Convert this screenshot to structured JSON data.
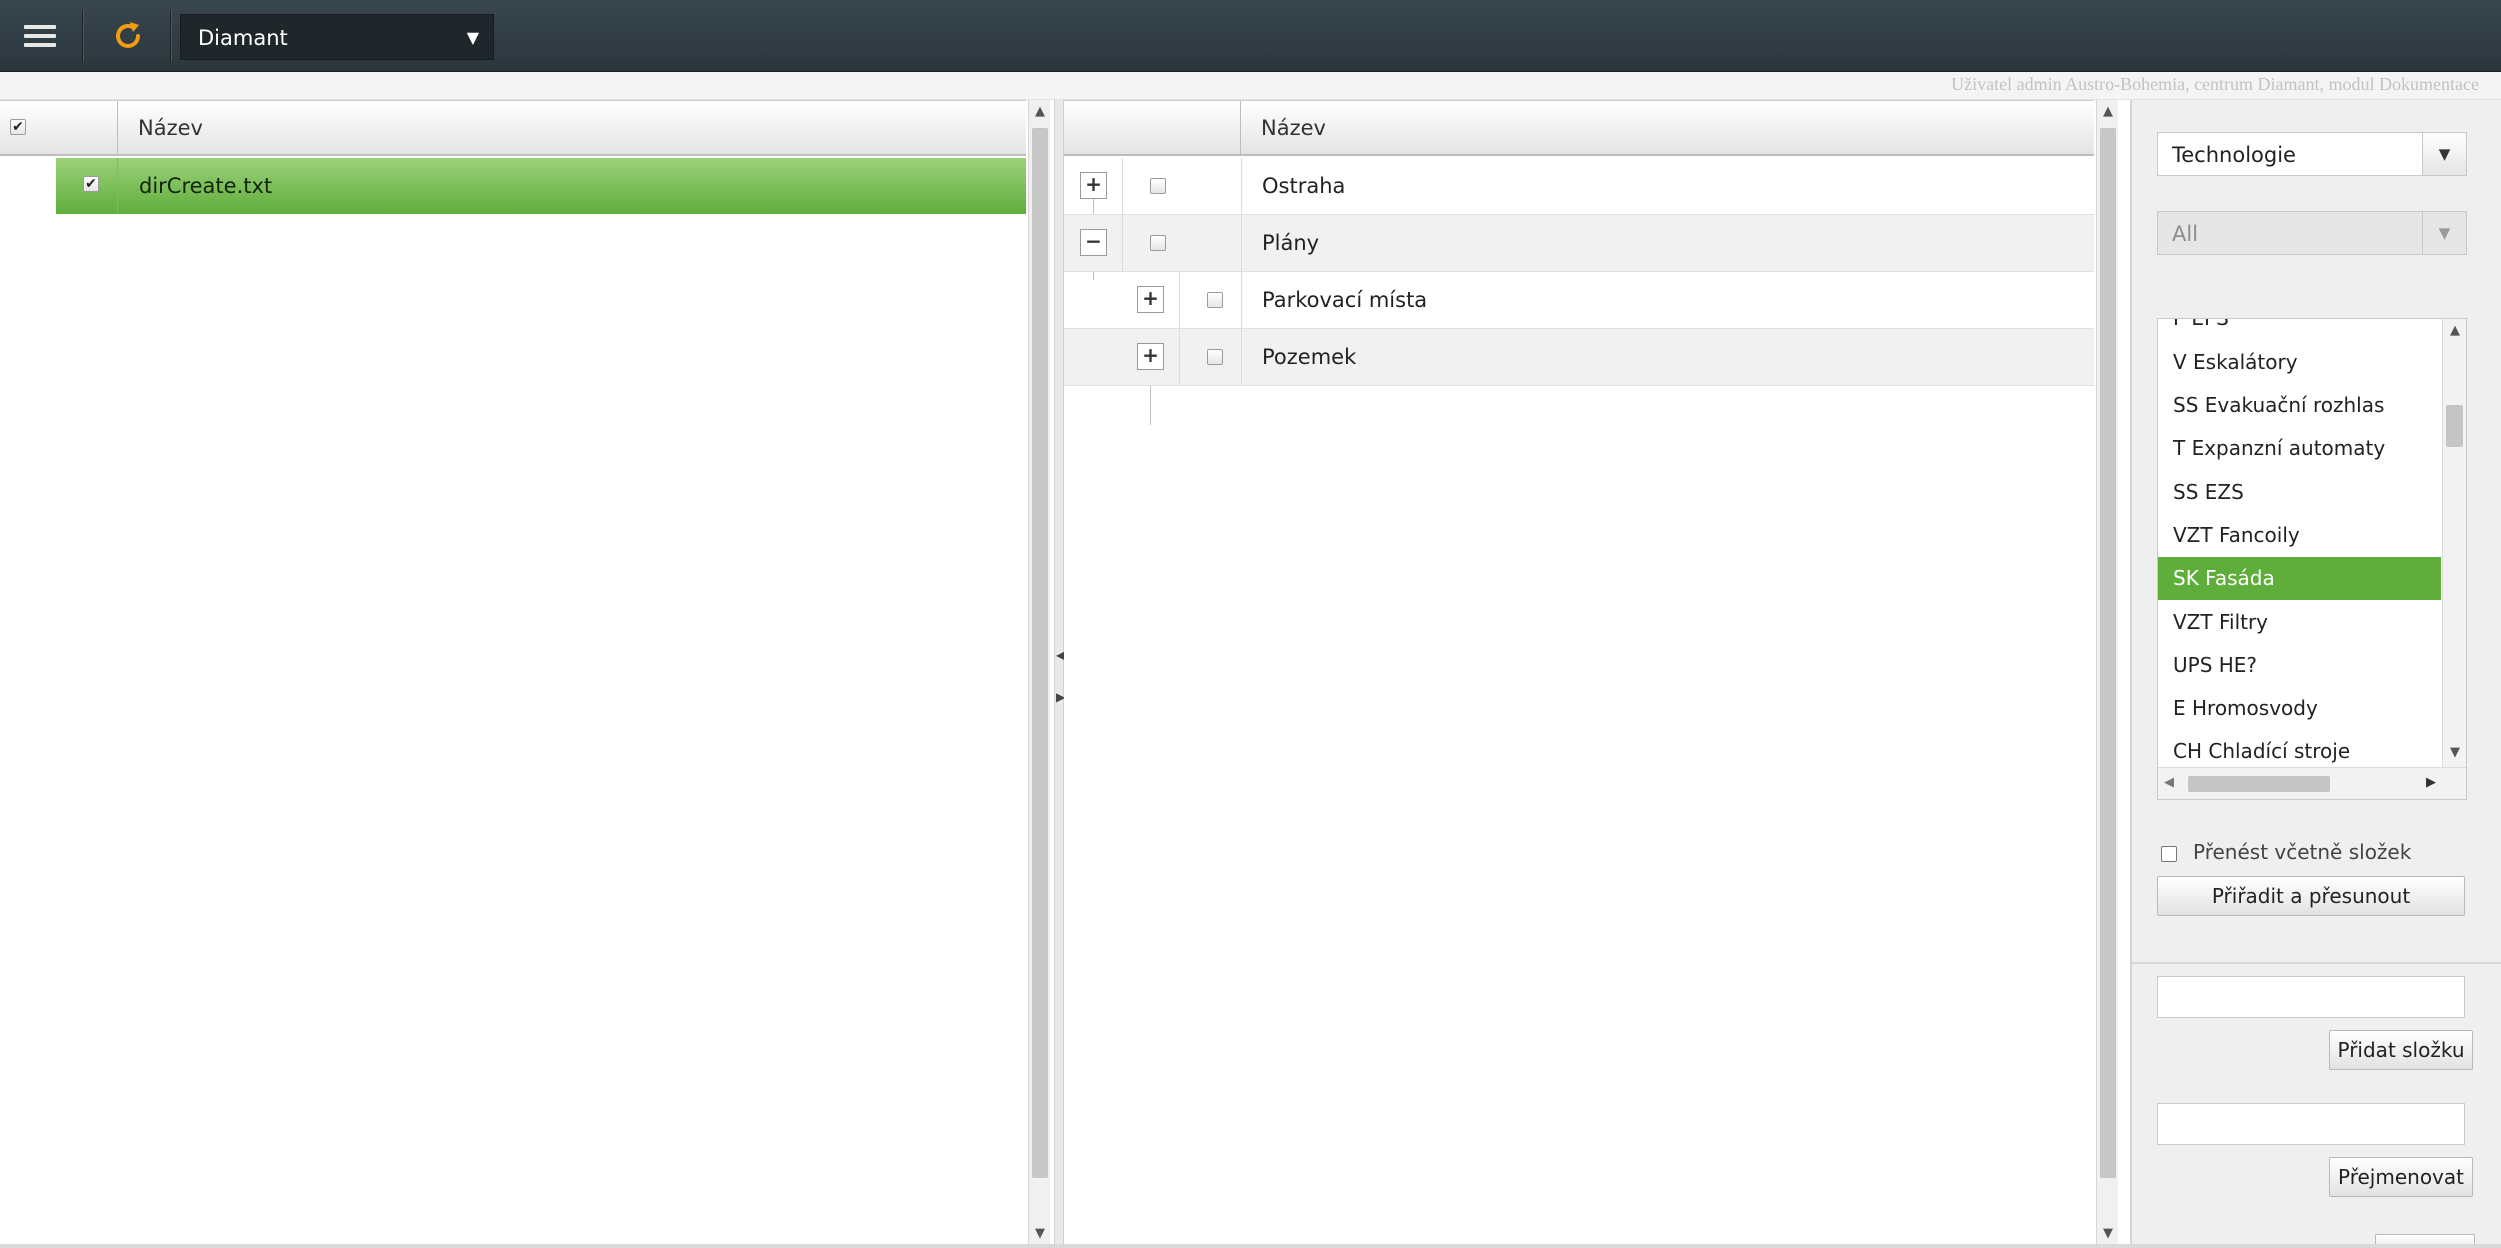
{
  "toolbar": {
    "center_value": "Diamant",
    "menu_icon": "hamburger-menu-icon",
    "refresh_icon": "refresh-icon",
    "refresh_color": "#f39c12"
  },
  "status": {
    "user_text": "Uživatel admin Austro-Bohemia, centrum Diamant, modul Dokumentace"
  },
  "files_grid": {
    "header_name": "Název",
    "rows": [
      {
        "name": "dirCreate.txt",
        "checked": true,
        "selected": true
      }
    ]
  },
  "folders_grid": {
    "header_name": "Název",
    "rows": [
      {
        "name": "Ostraha",
        "expander": "+"
      },
      {
        "name": "Plány",
        "expander": "−"
      },
      {
        "name": "Parkovací místa",
        "expander": "+"
      },
      {
        "name": "Pozemek",
        "expander": "+"
      }
    ]
  },
  "right_panel": {
    "category_select": "Technologie",
    "filter_select": "All",
    "list_items": [
      "P EPS",
      "V Eskalátory",
      "SS Evakuační rozhlas",
      "T Expanzní automaty",
      "SS EZS",
      "VZT Fancoily",
      "SK Fasáda",
      "VZT Filtry",
      "UPS HE?",
      "E Hromosvody",
      "CH Chladící stroje"
    ],
    "active_item": "SK Fasáda",
    "include_folders_label": "Přenést včetně složek",
    "assign_move_button": "Přiřadit a přesunout",
    "add_folder_button": "Přidat složku",
    "rename_button": "Přejmenovat",
    "accent_color": "#5fae3b"
  }
}
